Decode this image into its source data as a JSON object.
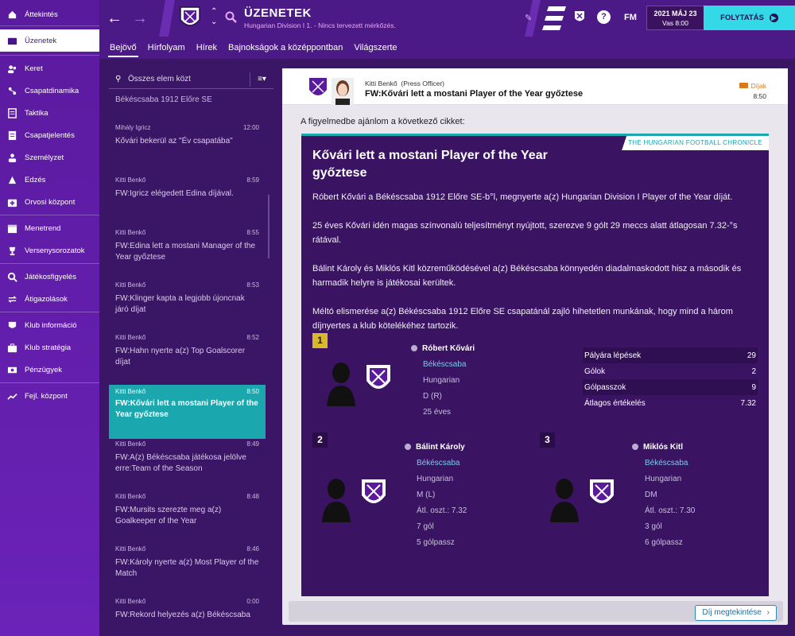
{
  "sidebar": {
    "items": [
      {
        "label": "Áttekintés",
        "icon": "home-icon"
      },
      {
        "label": "Üzenetek",
        "icon": "inbox-icon"
      },
      {
        "label": "Keret",
        "icon": "squad-icon"
      },
      {
        "label": "Csapatdinamika",
        "icon": "dynamics-icon"
      },
      {
        "label": "Taktika",
        "icon": "tactics-icon"
      },
      {
        "label": "Csapatjelentés",
        "icon": "report-icon"
      },
      {
        "label": "Személyzet",
        "icon": "staff-icon"
      },
      {
        "label": "Edzés",
        "icon": "training-icon"
      },
      {
        "label": "Orvosi központ",
        "icon": "medical-icon"
      },
      {
        "label": "Menetrend",
        "icon": "schedule-icon"
      },
      {
        "label": "Versenysorozatok",
        "icon": "trophy-icon"
      },
      {
        "label": "Játékosfigyelés",
        "icon": "scouting-icon"
      },
      {
        "label": "Átigazolások",
        "icon": "transfer-icon"
      },
      {
        "label": "Klub információ",
        "icon": "club-info-icon"
      },
      {
        "label": "Klub stratégia",
        "icon": "strategy-icon"
      },
      {
        "label": "Pénzügyek",
        "icon": "finance-icon"
      },
      {
        "label": "Fejl. központ",
        "icon": "development-icon"
      }
    ]
  },
  "topbar": {
    "title": "ÜZENETEK",
    "subtitle": "Hungarian Division I 1. - Nincs tervezett mérkőzés.",
    "fm_label": "FM",
    "date": "2021 MÁJ 23",
    "time": "Vas 8:00",
    "continue_label": "FOLYTATÁS"
  },
  "tabs": [
    "Bejövő",
    "Hírfolyam",
    "Hírek",
    "Bajnokságok a középpontban",
    "Világszerte"
  ],
  "list": {
    "search_placeholder": "Összes elem közt",
    "partial_top": "Békéscsaba 1912 Előre SE",
    "messages": [
      {
        "sender": "Mihály Igricz",
        "time": "12:00",
        "subject": "Kővári bekerül az \"Év csapatába\""
      },
      {
        "sender": "Kitti Benkő",
        "time": "8:59",
        "subject": "FW:Igricz elégedett Edina díjával."
      },
      {
        "sender": "Kitti Benkő",
        "time": "8:55",
        "subject": "FW:Edina lett a mostani Manager of the Year győztese"
      },
      {
        "sender": "Kitti Benkő",
        "time": "8:53",
        "subject": "FW:Klinger kapta a legjobb újoncnak járó díjat"
      },
      {
        "sender": "Kitti Benkő",
        "time": "8:52",
        "subject": "FW:Hahn nyerte a(z) Top Goalscorer díjat"
      },
      {
        "sender": "Kitti Benkő",
        "time": "8:50",
        "subject": "FW:Kővári lett a mostani Player of the Year győztese"
      },
      {
        "sender": "Kitti Benkő",
        "time": "8:49",
        "subject": "FW:A(z) Békéscsaba játékosa jelölve erre:Team of the Season"
      },
      {
        "sender": "Kitti Benkő",
        "time": "8:48",
        "subject": "FW:Mursits szerezte meg a(z) Goalkeeper of the Year"
      },
      {
        "sender": "Kitti Benkő",
        "time": "8:46",
        "subject": "FW:Károly nyerte a(z) Most Player of the Match"
      },
      {
        "sender": "Kitti Benkő",
        "time": "0:00",
        "subject": "FW:Rekord helyezés a(z) Békéscsaba"
      }
    ]
  },
  "detail": {
    "from_name": "Kitti Benkő",
    "from_role": "(Press Officer)",
    "subject": "FW:Kővári lett a mostani Player of the Year győztese",
    "tag": "Díjak",
    "time": "8:50",
    "intro": "A figyelmedbe ajánlom a következő cikket:",
    "button_label": "Díj megtekintése"
  },
  "article": {
    "source": "THE HUNGARIAN FOOTBALL CHRONICLE",
    "title": "Kővári lett a mostani Player of the Year győztese",
    "p1": "Róbert Kővári a Békéscsaba 1912 Előre SE-b°l, megnyerte a(z) Hungarian Division I Player of the Year díját.",
    "p2": "25 éves Kővári idén magas színvonalú teljesítményt nyújtott, szerezve 9 gólt 29 meccs alatt átlagosan 7.32-°s rátával.",
    "p3": "Bálint Károly és Miklós Kitl közreműködésével a(z) Békéscsaba könnyedén diadalmaskodott hisz a második és harmadik helyre is játékosai kerültek.",
    "p4": "Méltó elismerése a(z) Békéscsaba 1912 Előre SE csapatánál zajló hihetetlen munkának, hogy mind a három díjnyertes a klub kötelékéhez tartozik."
  },
  "players": [
    {
      "rank": "1",
      "name": "Róbert Kővári",
      "club": "Békéscsaba",
      "nation": "Hungarian",
      "pos": "D (R)",
      "extra": "25 éves",
      "stats": [
        {
          "label": "Pályára lépések",
          "value": "29"
        },
        {
          "label": "Gólok",
          "value": "2"
        },
        {
          "label": "Gólpasszok",
          "value": "9"
        },
        {
          "label": "Átlagos értékelés",
          "value": "7.32"
        }
      ]
    },
    {
      "rank": "2",
      "name": "Bálint Károly",
      "club": "Békéscsaba",
      "nation": "Hungarian",
      "pos": "M (L)",
      "avg": "Átl. oszt.: 7.32",
      "goals": "7 gól",
      "assists": "5 gólpassz"
    },
    {
      "rank": "3",
      "name": "Miklós Kitl",
      "club": "Békéscsaba",
      "nation": "Hungarian",
      "pos": "DM",
      "avg": "Átl. oszt.: 7.30",
      "goals": "3 gól",
      "assists": "6 gólpassz"
    }
  ],
  "colors": {
    "sidebar": "#5a1a9e",
    "accent": "#1aa7ad",
    "continue": "#34d9e8",
    "gold": "#d9b82c"
  }
}
